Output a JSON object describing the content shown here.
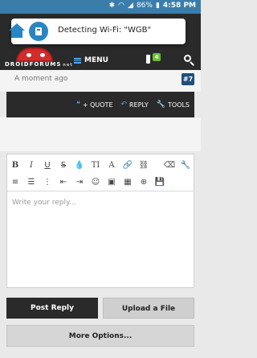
{
  "statusbar": {
    "battery": "86%",
    "time": "4:58 PM"
  },
  "toast": {
    "message": "Detecting Wi-Fi: \"WGB\""
  },
  "header": {
    "logo_main": "DROIDFORUMS",
    "logo_suffix": "net",
    "menu_label": "MENU",
    "alerts_count": "4"
  },
  "post": {
    "time": "A moment ago",
    "number": "#7"
  },
  "actions": {
    "quote": "+ QUOTE",
    "reply": "REPLY",
    "tools": "TOOLS"
  },
  "editor": {
    "placeholder": "Write your reply..."
  },
  "buttons": {
    "post_reply": "Post Reply",
    "upload": "Upload a File",
    "more_options": "More Options..."
  },
  "colors": {
    "accent": "#4da6ff",
    "statusbar": "#3a7dab",
    "header": "#2a2a2a",
    "badge": "#6abf36",
    "post_number": "#1f4e7a"
  }
}
